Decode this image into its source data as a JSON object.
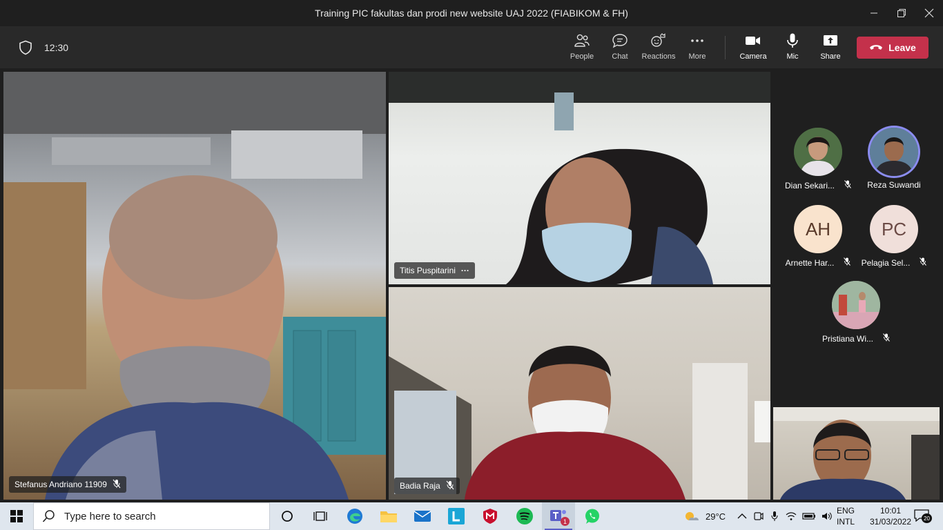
{
  "window": {
    "title": "Training PIC fakultas dan prodi new website UAJ 2022 (FIABIKOM & FH)"
  },
  "toolbar": {
    "timer": "12:30",
    "people_label": "People",
    "chat_label": "Chat",
    "reactions_label": "Reactions",
    "more_label": "More",
    "camera_label": "Camera",
    "mic_label": "Mic",
    "share_label": "Share",
    "leave_label": "Leave"
  },
  "videos": [
    {
      "name": "Stefanus Andriano 11909",
      "muted": true
    },
    {
      "name": "Titis Puspitarini",
      "more": "···"
    },
    {
      "name": "Badia Raja",
      "muted": true
    }
  ],
  "roster": [
    {
      "name": "Dian Sekari...",
      "muted": true
    },
    {
      "name": "Reza Suwandi",
      "muted": false,
      "speaking": true
    },
    {
      "name": "Arnette Har...",
      "initials": "AH",
      "muted": true
    },
    {
      "name": "Pelagia Sel...",
      "initials": "PC",
      "muted": true
    },
    {
      "name": "Pristiana Wi...",
      "muted": true
    }
  ],
  "taskbar": {
    "search_placeholder": "Type here to search",
    "weather": "29°C",
    "lang_top": "ENG",
    "lang_bottom": "INTL",
    "time": "10:01",
    "date": "31/03/2022",
    "notifications": "20",
    "teams_badge": "1"
  },
  "colors": {
    "leave": "#c4314b",
    "speaking_ring": "#8b8cf0",
    "taskbar": "#dfe6ee"
  }
}
